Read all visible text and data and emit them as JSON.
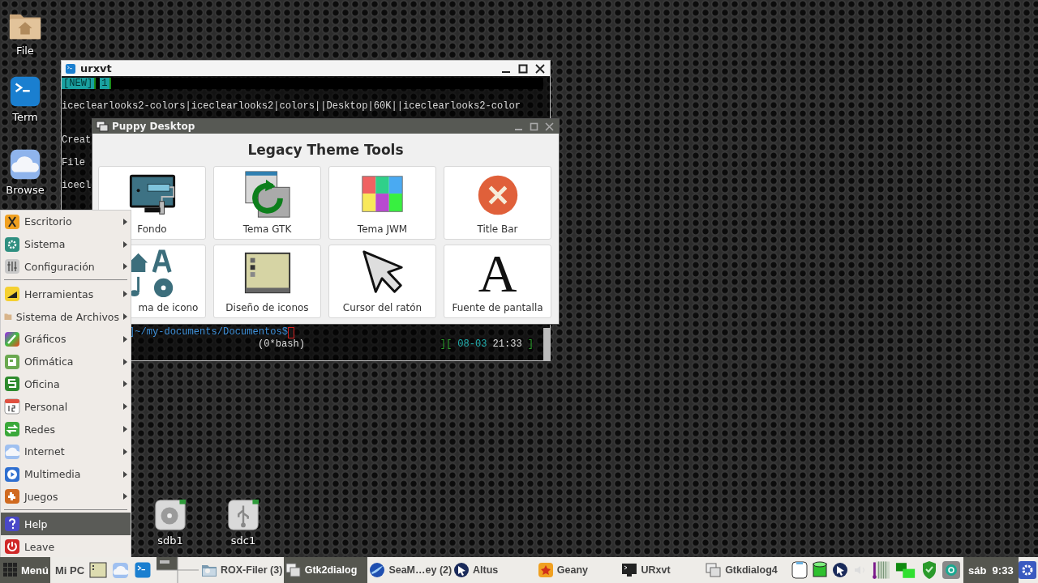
{
  "desktop_icons": [
    {
      "label": "File"
    },
    {
      "label": "Term"
    },
    {
      "label": "Browse"
    }
  ],
  "drive_icons": [
    {
      "label": "sdb1"
    },
    {
      "label": "sdc1"
    }
  ],
  "terminal": {
    "title": "urxvt",
    "tabs": [
      "[NEW]",
      "1"
    ],
    "paragraphs": [
      [
        "iceclearlooks2-colors|iceclearlooks2|colors||Desktop|60K||iceclearlooks2-color"
      ],
      [
        "Creat"
      ],
      [
        "File"
      ],
      [
        "icecl"
      ]
    ],
    "prompt": "]~/my-documents/Documentos$",
    "window_list": "(0*bash)",
    "status_open": "][",
    "date": "08-03",
    "time": "21:33",
    "status_close": "]"
  },
  "dialog": {
    "title": "Puppy Desktop",
    "heading": "Legacy Theme Tools",
    "tools": [
      {
        "label": "Fondo"
      },
      {
        "label": "Tema GTK"
      },
      {
        "label": "Tema JWM"
      },
      {
        "label": "Title Bar"
      },
      {
        "label": "ma de icono"
      },
      {
        "label": "Diseño de iconos"
      },
      {
        "label": "Cursor del ratón"
      },
      {
        "label": "Fuente de pantalla",
        "glyph": "A"
      }
    ]
  },
  "menu": {
    "items": [
      {
        "kind": "entry",
        "label": "Escritorio",
        "submenu": true,
        "selected": false
      },
      {
        "kind": "entry",
        "label": "Sistema",
        "submenu": true,
        "selected": false
      },
      {
        "kind": "entry",
        "label": "Configuración",
        "submenu": true,
        "selected": false
      },
      {
        "kind": "separator"
      },
      {
        "kind": "entry",
        "label": "Herramientas",
        "submenu": true,
        "selected": false
      },
      {
        "kind": "entry",
        "label": "Sistema de Archivos",
        "submenu": true,
        "selected": false
      },
      {
        "kind": "entry",
        "label": "Gráficos",
        "submenu": true,
        "selected": false
      },
      {
        "kind": "entry",
        "label": "Ofimática",
        "submenu": true,
        "selected": false
      },
      {
        "kind": "entry",
        "label": "Oficina",
        "submenu": true,
        "selected": false
      },
      {
        "kind": "entry",
        "label": "Personal",
        "submenu": true,
        "selected": false
      },
      {
        "kind": "entry",
        "label": "Redes",
        "submenu": true,
        "selected": false
      },
      {
        "kind": "entry",
        "label": "Internet",
        "submenu": true,
        "selected": false
      },
      {
        "kind": "entry",
        "label": "Multimedia",
        "submenu": true,
        "selected": false
      },
      {
        "kind": "entry",
        "label": "Juegos",
        "submenu": true,
        "selected": false
      },
      {
        "kind": "separator"
      },
      {
        "kind": "entry",
        "label": "Help",
        "submenu": false,
        "selected": true
      },
      {
        "kind": "entry",
        "label": "Leave",
        "submenu": false,
        "selected": false
      }
    ]
  },
  "taskbar": {
    "menu_label": "Menú",
    "places_label": "Mi PC",
    "tasks": [
      {
        "label": "ROX-Filer (3)",
        "selected": false
      },
      {
        "label": "Gtk2dialog",
        "selected": true
      },
      {
        "label": "SeaM…ey (2)",
        "selected": false
      },
      {
        "label": "Altus",
        "selected": false
      },
      {
        "label": "Geany",
        "selected": false
      },
      {
        "label": "URxvt",
        "selected": false
      },
      {
        "label": "Gtkdialog4",
        "selected": false
      }
    ],
    "clock": "sáb  9:33"
  }
}
